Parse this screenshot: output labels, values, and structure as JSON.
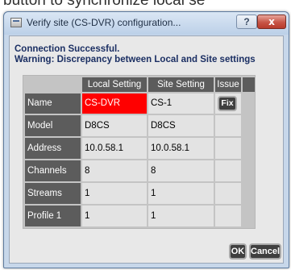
{
  "top_clipped_text": "button to synchronize local se",
  "window": {
    "title": "Verify site (CS-DVR) configuration...",
    "help_label": "?",
    "close_label": "x"
  },
  "status": {
    "line1": "Connection Successful.",
    "line2": "Warning: Discrepancy between Local and Site settings"
  },
  "table": {
    "headers": {
      "local": "Local Setting",
      "site": "Site Setting",
      "issue": "Issue"
    },
    "rows": [
      {
        "label": "Name",
        "local": "CS-DVR",
        "site": "CS-1",
        "issue": "Fix",
        "mismatch": true
      },
      {
        "label": "Model",
        "local": "D8CS",
        "site": "D8CS",
        "issue": "",
        "mismatch": false
      },
      {
        "label": "Address",
        "local": "10.0.58.1",
        "site": "10.0.58.1",
        "issue": "",
        "mismatch": false
      },
      {
        "label": "Channels",
        "local": "8",
        "site": "8",
        "issue": "",
        "mismatch": false
      },
      {
        "label": "Streams",
        "local": "1",
        "site": "1",
        "issue": "",
        "mismatch": false
      },
      {
        "label": "Profile 1",
        "local": "1",
        "site": "1",
        "issue": "",
        "mismatch": false
      }
    ]
  },
  "buttons": {
    "ok": "OK",
    "cancel": "Cancel"
  },
  "colors": {
    "mismatch": "#ff0000",
    "header_bg": "#5c5c5c",
    "status_text": "#1b2f63",
    "button_bg": "#3f3f3f"
  },
  "icons": {
    "app": "dvr-window-icon",
    "help": "question-mark",
    "close": "close-x"
  }
}
